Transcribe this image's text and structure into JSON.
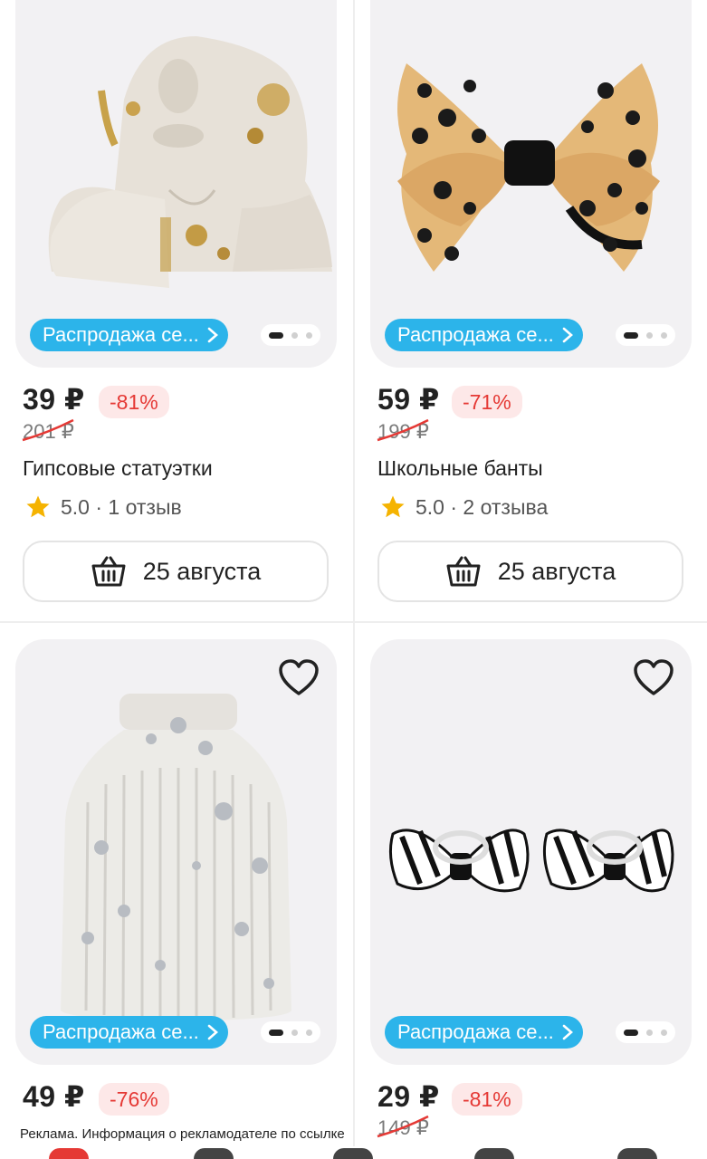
{
  "products": [
    {
      "price": "39 ₽",
      "discount": "-81%",
      "old_price": "201 ₽",
      "title": "Гипсовые статуэтки",
      "rating": "5.0 · 1 отзыв",
      "promo": "Распродажа се...",
      "delivery": "25 августа",
      "image": "plaster-bust-figurine"
    },
    {
      "price": "59 ₽",
      "discount": "-71%",
      "old_price": "199 ₽",
      "title": "Школьные банты",
      "rating": "5.0 · 2 отзыва",
      "promo": "Распродажа се...",
      "delivery": "25 августа",
      "image": "leopard-hair-bow"
    },
    {
      "price": "49 ₽",
      "discount": "-76%",
      "old_price": "",
      "promo": "Распродажа се...",
      "image": "ribbed-plaster-vase"
    },
    {
      "price": "29 ₽",
      "discount": "-81%",
      "old_price": "149 ₽",
      "promo": "Распродажа се...",
      "image": "zebra-hair-bows"
    }
  ],
  "ad_disclaimer": "Реклама. Информация о рекламодателе по ссылке",
  "colors": {
    "promo_badge": "#2cb4ea",
    "discount_text": "#e53935",
    "discount_bg": "#fde8e8",
    "rating_star": "#f5b301"
  },
  "icons": [
    "chevron-right-icon",
    "heart-icon",
    "star-icon",
    "basket-icon"
  ]
}
